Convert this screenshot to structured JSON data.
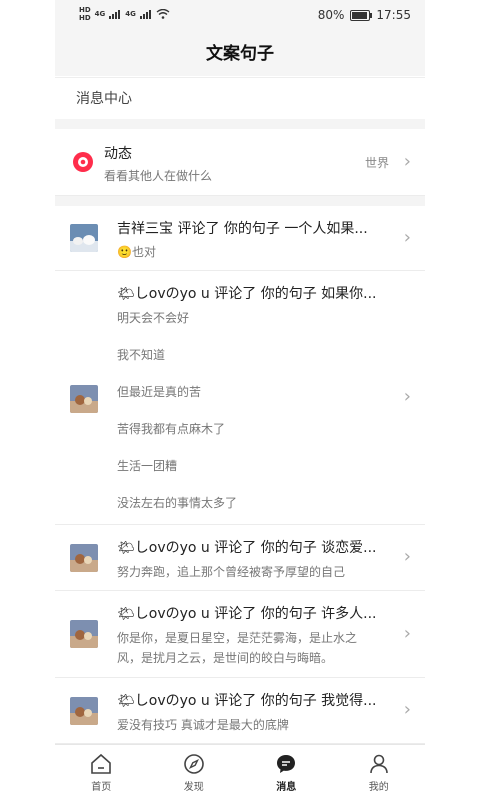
{
  "status_bar": {
    "left_labels": [
      "HD",
      "HD",
      "4G",
      "4G"
    ],
    "battery": "80%",
    "battery_level": 0.8,
    "time": "17:55"
  },
  "header": {
    "title": "文案句子"
  },
  "section": {
    "title": "消息中心"
  },
  "dynamic": {
    "title": "动态",
    "subtitle": "看看其他人在做什么",
    "right_label": "世界"
  },
  "messages": [
    {
      "title": "吉祥三宝 评论了 你的句子 一个人如果...",
      "content": [
        "🙂也对"
      ]
    },
    {
      "title": "🌤しovのyo u 评论了 你的句子 如果你...",
      "content": [
        "明天会不会好",
        "我不知道",
        "但最近是真的苦",
        "苦得我都有点麻木了",
        "生活一团糟",
        "没法左右的事情太多了"
      ]
    },
    {
      "title": "🌤しovのyo u 评论了 你的句子 谈恋爱...",
      "content": [
        "努力奔跑，追上那个曾经被寄予厚望的自己"
      ]
    },
    {
      "title": "🌤しovのyo u 评论了 你的句子 许多人...",
      "content": [
        "你是你，是夏日星空，是茫茫雾海，是止水之",
        "风，是扰月之云，是世间的皎白与晦暗。"
      ]
    },
    {
      "title": "🌤しovのyo u 评论了 你的句子 我觉得...",
      "content": [
        "爱没有技巧 真诚才是最大的底牌"
      ]
    }
  ],
  "tabs": [
    {
      "label": "首页",
      "icon": "home-icon"
    },
    {
      "label": "发现",
      "icon": "compass-icon"
    },
    {
      "label": "消息",
      "icon": "chat-icon"
    },
    {
      "label": "我的",
      "icon": "person-icon"
    }
  ],
  "colors": {
    "accent_red": "#ff2d4b"
  }
}
